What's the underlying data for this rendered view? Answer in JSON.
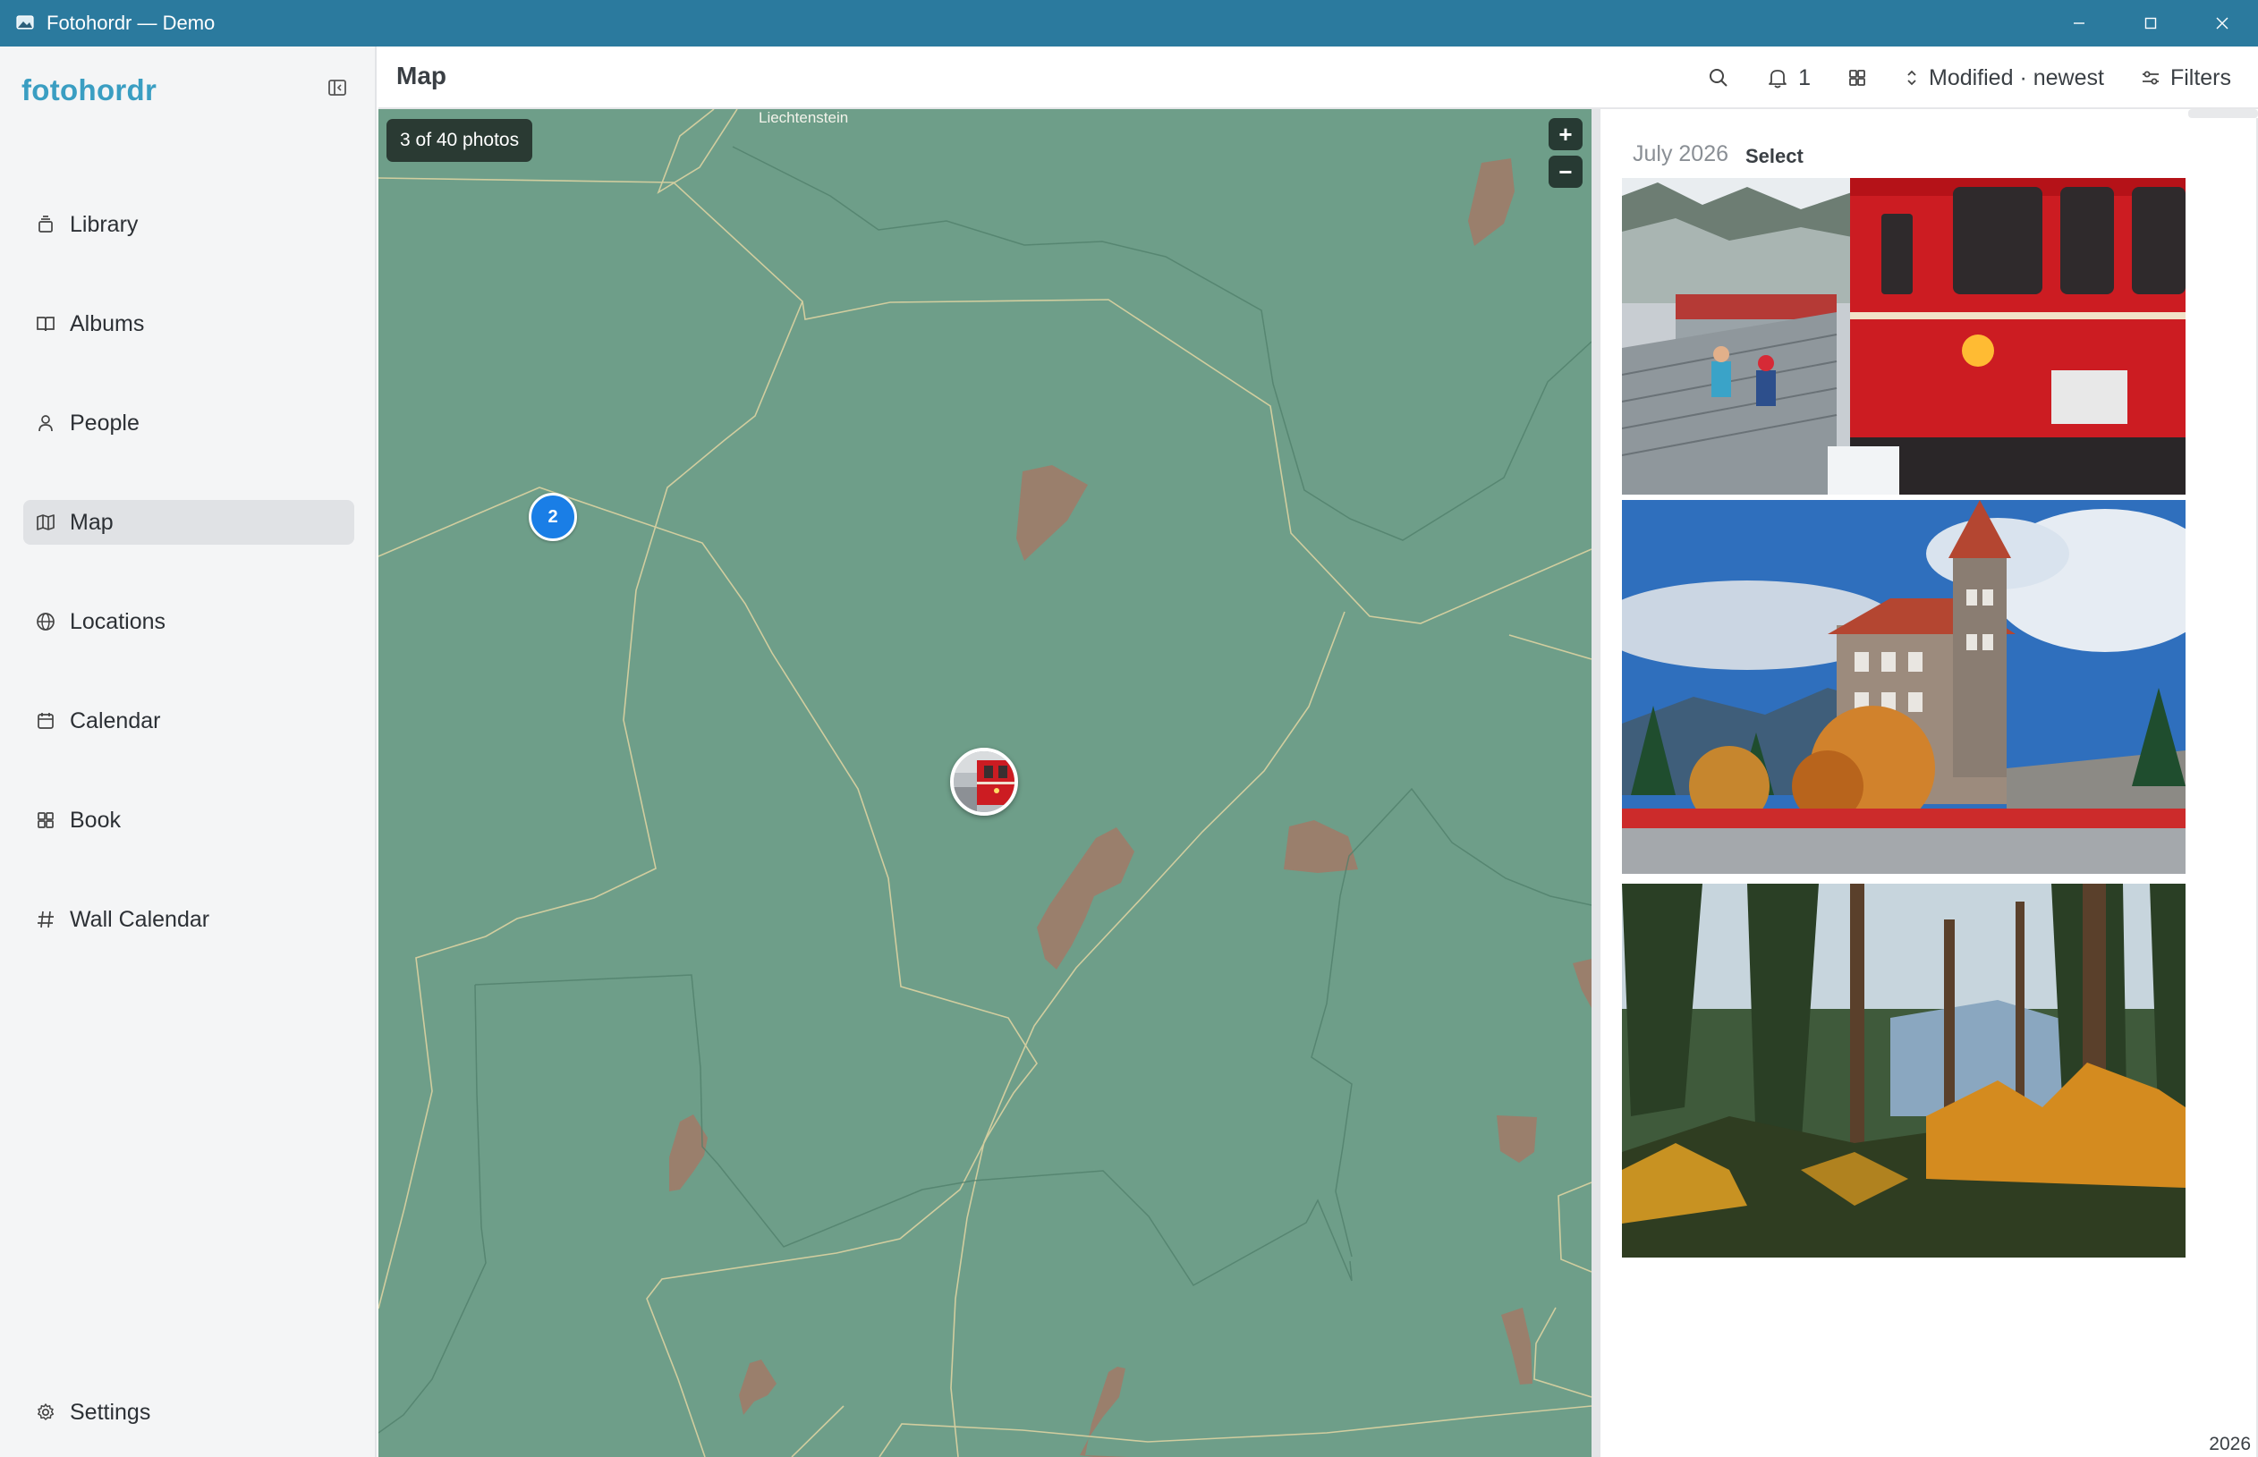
{
  "window": {
    "title": "Fotohordr — Demo"
  },
  "sidebar": {
    "brand": "fotohordr",
    "items": [
      {
        "label": "Library",
        "icon": "library-icon",
        "active": false
      },
      {
        "label": "Albums",
        "icon": "book-open-icon",
        "active": false
      },
      {
        "label": "People",
        "icon": "person-icon",
        "active": false
      },
      {
        "label": "Map",
        "icon": "map-icon",
        "active": true
      },
      {
        "label": "Locations",
        "icon": "globe-icon",
        "active": false
      },
      {
        "label": "Calendar",
        "icon": "calendar-icon",
        "active": false
      },
      {
        "label": "Book",
        "icon": "grid-icon",
        "active": false
      },
      {
        "label": "Wall Calendar",
        "icon": "hash-icon",
        "active": false
      }
    ],
    "settings": "Settings"
  },
  "header": {
    "title": "Map",
    "notifications_count": "1",
    "sort_label": "Modified · newest",
    "filters_label": "Filters"
  },
  "map": {
    "photo_count": "3 of 40 photos",
    "place_label": "Liechtenstein",
    "cluster_count": "2",
    "zoom_in": "+",
    "zoom_out": "−"
  },
  "panel": {
    "month": "July 2026",
    "select_label": "Select",
    "year": "2026",
    "photos": [
      "red-train-station-photo",
      "castle-hotel-autumn-photo",
      "forest-autumn-photo"
    ]
  },
  "colors": {
    "titlebar": "#2b7a9e",
    "brand": "#3a9ec2",
    "map_land": "#6e9e89",
    "cluster": "#1a7ee6"
  }
}
